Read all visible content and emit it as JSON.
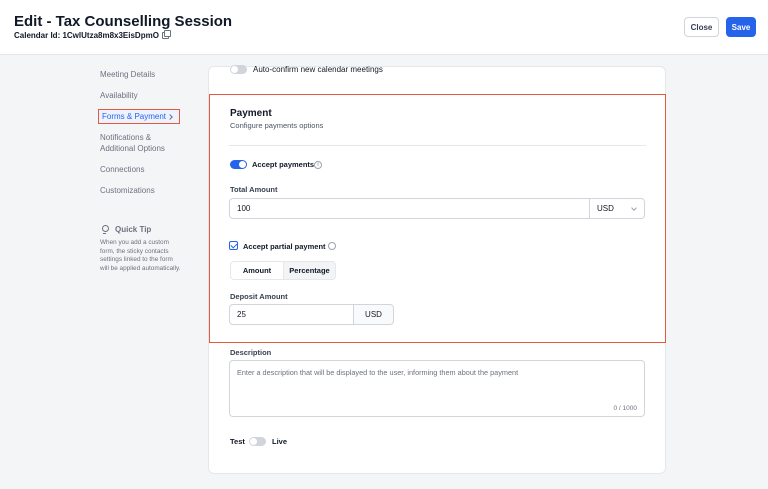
{
  "header": {
    "title": "Edit - Tax Counselling Session",
    "calendar_id": "Calendar Id: 1CwlUtza8m8x3EisDpmO",
    "close_label": "Close",
    "save_label": "Save"
  },
  "nav": {
    "items": [
      {
        "label": "Meeting Details"
      },
      {
        "label": "Availability"
      },
      {
        "label": "Forms & Payment"
      },
      {
        "label": "Notifications &"
      },
      {
        "label": "Additional Options"
      },
      {
        "label": "Connections"
      },
      {
        "label": "Customizations"
      }
    ]
  },
  "tip": {
    "title": "Quick Tip",
    "body": "When you add a custom form, the sticky contacts settings linked to the form will be applied automatically."
  },
  "settings": {
    "auto_confirm_label": "Auto-confirm new calendar meetings"
  },
  "payment": {
    "title": "Payment",
    "subtitle": "Configure payments options",
    "accept_label": "Accept payments",
    "total_amount_label": "Total Amount",
    "total_amount_value": "100",
    "currency": "USD",
    "partial_label": "Accept partial payment",
    "seg_amount": "Amount",
    "seg_percentage": "Percentage",
    "deposit_label": "Deposit Amount",
    "deposit_value": "25",
    "deposit_unit": "USD"
  },
  "description": {
    "label": "Description",
    "placeholder": "Enter a description that will be displayed to the user, informing them about the payment",
    "count": "0 / 1000"
  },
  "mode": {
    "test_label": "Test",
    "live_label": "Live"
  },
  "colors": {
    "accent": "#2563eb",
    "highlight": "#e55a3c"
  }
}
